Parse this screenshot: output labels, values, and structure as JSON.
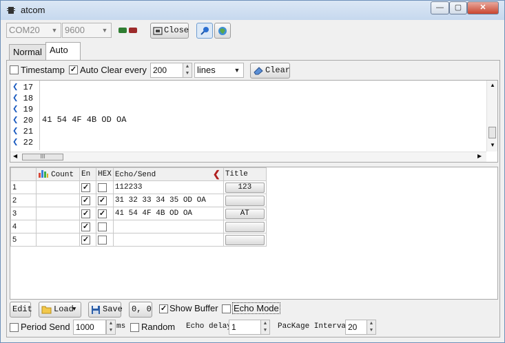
{
  "window": {
    "title": "atcom"
  },
  "titlebar_buttons": {
    "minimize": "—",
    "maximize": "▢",
    "close": "✕"
  },
  "toolbar": {
    "port": "COM20",
    "baud": "9600",
    "close_label": "Close"
  },
  "tabs": [
    {
      "label": "Normal"
    },
    {
      "label": "Auto"
    }
  ],
  "options": {
    "timestamp_label": "Timestamp",
    "timestamp_checked": "",
    "auto_clear_label": "Auto Clear every",
    "auto_clear_checked": "✓",
    "auto_clear_value": "200",
    "auto_clear_unit": "lines",
    "clear_label": "Clear"
  },
  "log": {
    "lines": [
      {
        "num": "17",
        "text": ""
      },
      {
        "num": "18",
        "text": ""
      },
      {
        "num": "19",
        "text": ""
      },
      {
        "num": "20",
        "text": "41 54 4F 4B OD OA"
      },
      {
        "num": "21",
        "text": ""
      },
      {
        "num": "22",
        "text": ""
      }
    ],
    "hscroll_grip": "III"
  },
  "grid": {
    "headers": {
      "count": "Count",
      "en": "En",
      "hex": "HEX",
      "echo": "Echo/Send",
      "title": "Title"
    },
    "rows": [
      {
        "num": "1",
        "en": "✓",
        "hex": "",
        "send": "112233",
        "title": "123"
      },
      {
        "num": "2",
        "en": "✓",
        "hex": "✓",
        "send": "31 32 33 34 35 OD OA",
        "title": ""
      },
      {
        "num": "3",
        "en": "✓",
        "hex": "✓",
        "send": "41 54 4F 4B OD OA",
        "title": "AT"
      },
      {
        "num": "4",
        "en": "✓",
        "hex": "",
        "send": "",
        "title": ""
      },
      {
        "num": "5",
        "en": "✓",
        "hex": "",
        "send": "",
        "title": ""
      }
    ]
  },
  "bottom": {
    "edit_label": "Edit",
    "load_label": "Load",
    "save_label": "Save",
    "coords": "0, 0",
    "show_buffer_label": "Show Buffer",
    "show_buffer_checked": "✓",
    "echo_mode_label": "Echo Mode",
    "echo_mode_checked": ""
  },
  "status": {
    "period_send_label": "Period Send",
    "period_send_checked": "",
    "period_value": "1000",
    "period_unit": "ms",
    "random_label": "Random",
    "random_checked": "",
    "echo_delay_label": "Echo delay",
    "echo_delay_value": "1",
    "package_interval_label": "PacKage Interval",
    "package_interval_value": "20"
  }
}
